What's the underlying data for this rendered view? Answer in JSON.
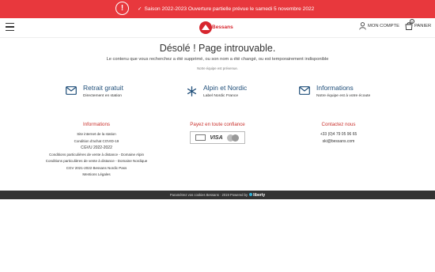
{
  "alert": {
    "icon": "exclamation-icon",
    "check": "✓",
    "text": "Saison 2022-2023 Ouverture partielle prévue le samedi 5 novembre 2022"
  },
  "header": {
    "logo_text": "Bessans",
    "account_label": "MON COMPTE",
    "cart_label": "PANIER",
    "cart_count": "0"
  },
  "main": {
    "title": "Désolé ! Page introuvable.",
    "subtitle": "Le contenu que vous recherchez a été supprimé, ou son nom a été changé, ou est temporairement indisponible",
    "team_note": "Notre équipe est prévenue."
  },
  "features": [
    {
      "title": "Retrait gratuit",
      "desc": "Directement en station",
      "icon": "mail-icon"
    },
    {
      "title": "Alpin et Nordic",
      "desc": "Label Nordic France",
      "icon": "snowflake-icon"
    },
    {
      "title": "Informations",
      "desc": "Notre équipe est à votre écoute",
      "icon": "mail-icon"
    }
  ],
  "footer": {
    "info_title": "Informations",
    "links": [
      "Site internet de la station",
      "Condition d'achat COVID-19",
      "CGVU 2022-2022",
      "Conditions particulières de vente à distance - Domaine Alpin",
      "Conditions particulières de vente à distance - Domaine Nordique",
      "CGV 2021-2022 Bessans Nordic Pass",
      "Mentions Légales"
    ],
    "payment_title": "Payez en toute confiance",
    "payment_visa": "VISA",
    "contact_title": "Contactez nous",
    "phone": "+33 (0)4 79 05 96 65",
    "email": "ski@bessans.com"
  },
  "bottom_bar": {
    "text": "Paramétrez vos cookies Bessans · 2019 Powered by",
    "brand": "liberty"
  },
  "colors": {
    "alert_red": "#e8383d",
    "brand_red": "#d7262e",
    "link_red": "#c9302c",
    "feature_blue": "#1f4e79",
    "footer_dark": "#333333"
  }
}
